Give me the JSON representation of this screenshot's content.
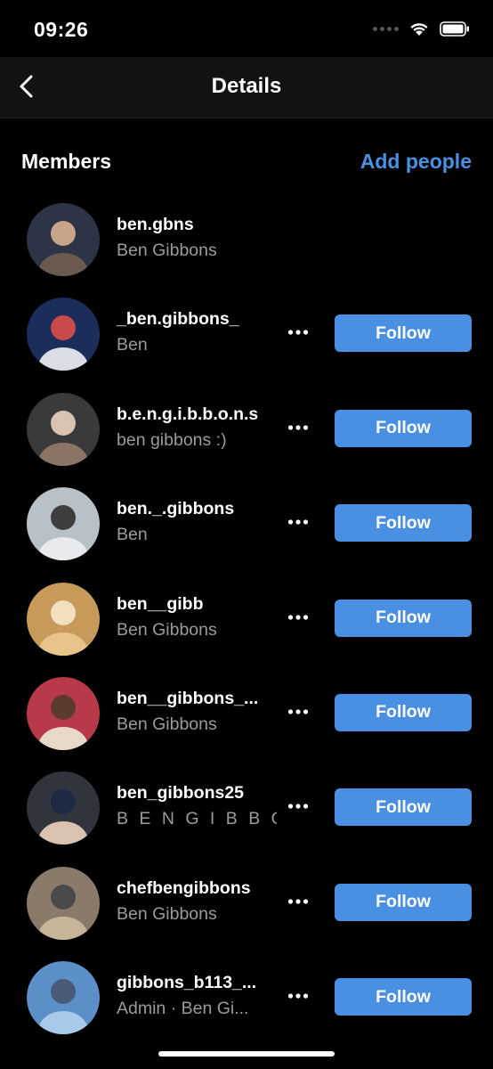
{
  "status_bar": {
    "time": "09:26"
  },
  "nav": {
    "title": "Details",
    "back_icon": "chevron-left-icon"
  },
  "members_section": {
    "title": "Members",
    "add_people_label": "Add people"
  },
  "colors": {
    "accent": "#4a90e2",
    "secondary_text": "#9b9b9b",
    "background": "#000000"
  },
  "members": [
    {
      "username": "ben.gbns",
      "full_name": "Ben Gibbons",
      "follow_label": "",
      "show_actions": false
    },
    {
      "username": "_ben.gibbons_",
      "full_name": "Ben",
      "follow_label": "Follow",
      "show_actions": true
    },
    {
      "username": "b.e.n.g.i.b.b.o.n.s",
      "full_name": "ben gibbons :)",
      "follow_label": "Follow",
      "show_actions": true
    },
    {
      "username": "ben._.gibbons",
      "full_name": "Ben",
      "follow_label": "Follow",
      "show_actions": true
    },
    {
      "username": "ben__gibb",
      "full_name": "Ben Gibbons",
      "follow_label": "Follow",
      "show_actions": true
    },
    {
      "username": "ben__gibbons_...",
      "full_name": "Ben Gibbons",
      "follow_label": "Follow",
      "show_actions": true
    },
    {
      "username": "ben_gibbons25",
      "full_name": "B E N G I B B O...",
      "follow_label": "Follow",
      "show_actions": true
    },
    {
      "username": "chefbengibbons",
      "full_name": "Ben Gibbons",
      "follow_label": "Follow",
      "show_actions": true
    },
    {
      "username": "gibbons_b113_...",
      "full_name": "Admin · Ben Gi...",
      "follow_label": "Follow",
      "show_actions": true
    }
  ]
}
